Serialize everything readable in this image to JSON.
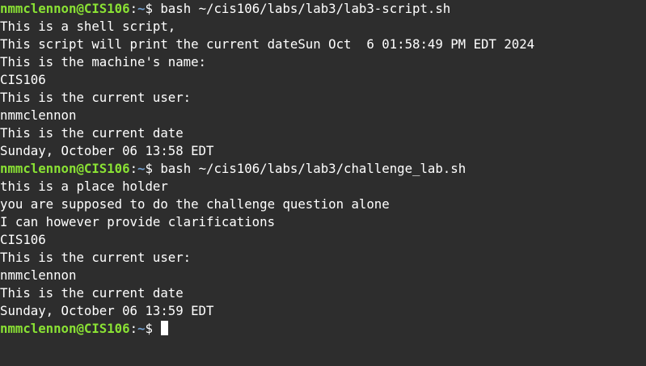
{
  "prompt": {
    "user_host": "nmmclennon@CIS106",
    "colon": ":",
    "cwd": "~",
    "symbol": "$ "
  },
  "commands": [
    "bash ~/cis106/labs/lab3/lab3-script.sh",
    "bash ~/cis106/labs/lab3/challenge_lab.sh"
  ],
  "output_block_1": [
    "This is a shell script,",
    "This script will print the current dateSun Oct  6 01:58:49 PM EDT 2024",
    "This is the machine's name:",
    "CIS106",
    "This is the current user:",
    "nmmclennon",
    "This is the current date",
    "Sunday, October 06 13:58 EDT"
  ],
  "output_block_2": [
    "this is a place holder",
    "you are supposed to do the challenge question alone",
    "I can however provide clarifications",
    "CIS106",
    "This is the current user:",
    "nmmclennon",
    "This is the current date",
    "Sunday, October 06 13:59 EDT"
  ]
}
